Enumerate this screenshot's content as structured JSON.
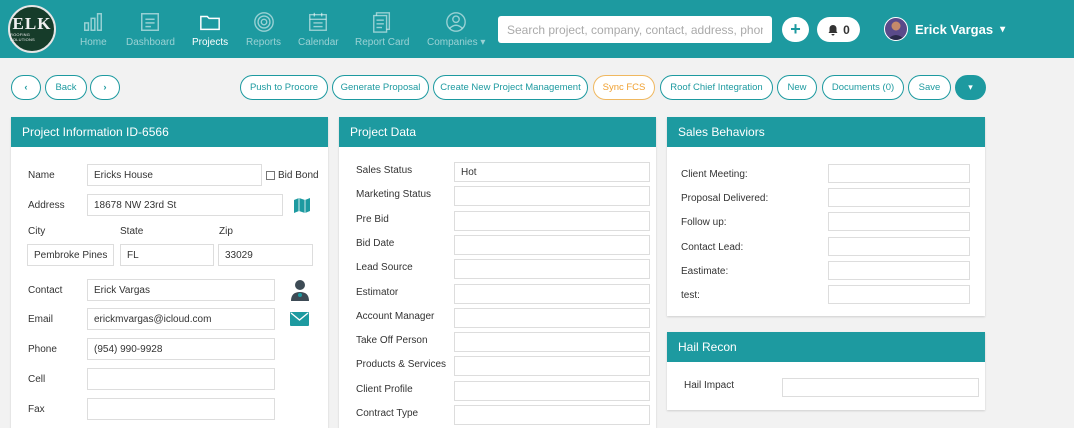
{
  "logo": {
    "big": "ELK",
    "small": "ROOFING SOLUTIONS"
  },
  "nav": {
    "items": [
      {
        "label": "Home"
      },
      {
        "label": "Dashboard"
      },
      {
        "label": "Projects"
      },
      {
        "label": "Reports"
      },
      {
        "label": "Calendar"
      },
      {
        "label": "Report Card"
      },
      {
        "label": "Companies ▾"
      }
    ],
    "search_placeholder": "Search project, company, contact, address, phone",
    "notification_count": "0",
    "user_name": "Erick Vargas",
    "user_caret": "▾"
  },
  "toolbar": {
    "back": "Back",
    "push": "Push to Procore",
    "proposal": "Generate Proposal",
    "create_pm": "Create New Project Management",
    "sync": "Sync FCS",
    "roof_chief": "Roof Chief Integration",
    "new": "New",
    "documents": "Documents (0)",
    "save": "Save"
  },
  "project_info": {
    "title": "Project Information ID-6566",
    "name_label": "Name",
    "name_value": "Ericks House",
    "bid_bond": "Bid Bond",
    "address_label": "Address",
    "address_value": "18678 NW 23rd St",
    "city_label": "City",
    "city_value": "Pembroke Pines",
    "state_label": "State",
    "state_value": "FL",
    "zip_label": "Zip",
    "zip_value": "33029",
    "contact_label": "Contact",
    "contact_value": "Erick Vargas",
    "email_label": "Email",
    "email_value": "erickmvargas@icloud.com",
    "phone_label": "Phone",
    "phone_value": "(954) 990-9928",
    "cell_label": "Cell",
    "cell_value": "",
    "fax_label": "Fax",
    "fax_value": ""
  },
  "project_data": {
    "title": "Project Data",
    "rows": [
      {
        "label": "Sales Status",
        "value": "Hot"
      },
      {
        "label": "Marketing Status",
        "value": ""
      },
      {
        "label": "Pre Bid",
        "value": ""
      },
      {
        "label": "Bid Date",
        "value": ""
      },
      {
        "label": "Lead Source",
        "value": ""
      },
      {
        "label": "Estimator",
        "value": ""
      },
      {
        "label": "Account Manager",
        "value": ""
      },
      {
        "label": "Take Off Person",
        "value": ""
      },
      {
        "label": "Products & Services",
        "value": ""
      },
      {
        "label": "Client Profile",
        "value": ""
      },
      {
        "label": "Contract Type",
        "value": ""
      }
    ]
  },
  "sales_behaviors": {
    "title": "Sales Behaviors",
    "rows": [
      {
        "label": "Client Meeting:",
        "value": ""
      },
      {
        "label": "Proposal Delivered:",
        "value": ""
      },
      {
        "label": "Follow up:",
        "value": ""
      },
      {
        "label": "Contact Lead:",
        "value": ""
      },
      {
        "label": "Eastimate:",
        "value": ""
      },
      {
        "label": "test:",
        "value": ""
      }
    ]
  },
  "hail_recon": {
    "title": "Hail Recon",
    "impact_label": "Hail Impact",
    "impact_value": ""
  },
  "colors": {
    "accent": "#1d9aa0",
    "sync": "#f0a030"
  }
}
